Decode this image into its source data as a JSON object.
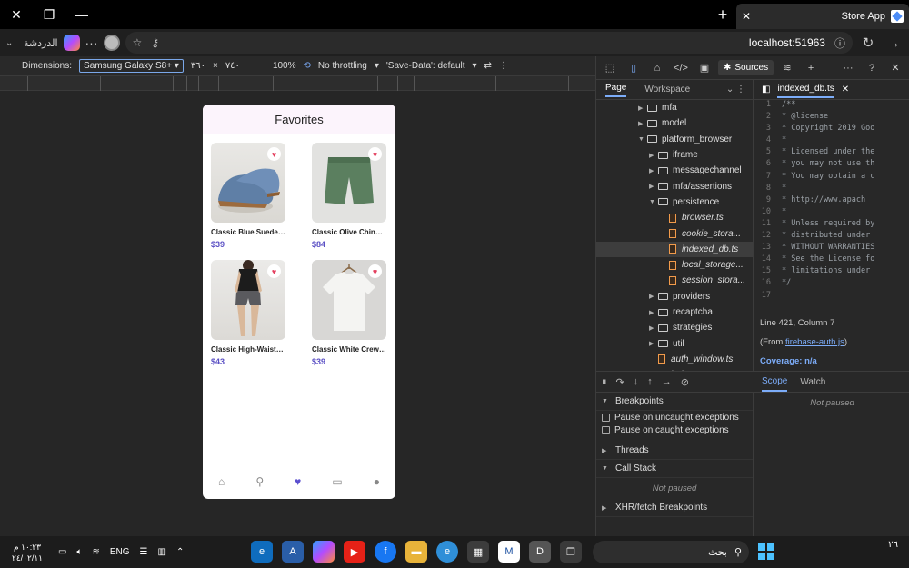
{
  "window": {
    "tab_title": "Store App"
  },
  "addressbar": {
    "copilot_label": "الدردشة",
    "url": "localhost:51963"
  },
  "device_toolbar": {
    "dimensions_label": "Dimensions:",
    "device": "Samsung Galaxy S8+",
    "width": "٣٦٠",
    "height": "٧٤٠",
    "zoom": "100%",
    "throttling": "No throttling",
    "save_data": "'Save-Data': default"
  },
  "app": {
    "header_title": "Favorites",
    "products": [
      {
        "name": "Classic Blue Suede ...",
        "price": "$39"
      },
      {
        "name": "Classic Olive Chino ...",
        "price": "$84"
      },
      {
        "name": "Classic High-Waiste...",
        "price": "$43"
      },
      {
        "name": "Classic White Crew ...",
        "price": "$39"
      }
    ]
  },
  "devtools": {
    "sources_tab": "Sources",
    "nav_tabs": [
      "Page",
      "Workspace"
    ],
    "tree": [
      {
        "label": "mfa",
        "type": "folder",
        "depth": 2,
        "expanded": false
      },
      {
        "label": "model",
        "type": "folder",
        "depth": 2,
        "expanded": false
      },
      {
        "label": "platform_browser",
        "type": "folder",
        "depth": 2,
        "expanded": true
      },
      {
        "label": "iframe",
        "type": "folder",
        "depth": 3,
        "expanded": false
      },
      {
        "label": "messagechannel",
        "type": "folder",
        "depth": 3,
        "expanded": false
      },
      {
        "label": "mfa/assertions",
        "type": "folder",
        "depth": 3,
        "expanded": false
      },
      {
        "label": "persistence",
        "type": "folder",
        "depth": 3,
        "expanded": true
      },
      {
        "label": "browser.ts",
        "type": "file",
        "depth": 4
      },
      {
        "label": "cookie_stora...",
        "type": "file",
        "depth": 4
      },
      {
        "label": "indexed_db.ts",
        "type": "file",
        "depth": 4,
        "selected": true
      },
      {
        "label": "local_storage...",
        "type": "file",
        "depth": 4
      },
      {
        "label": "session_stora...",
        "type": "file",
        "depth": 4
      },
      {
        "label": "providers",
        "type": "folder",
        "depth": 3,
        "expanded": false
      },
      {
        "label": "recaptcha",
        "type": "folder",
        "depth": 3,
        "expanded": false
      },
      {
        "label": "strategies",
        "type": "folder",
        "depth": 3,
        "expanded": false
      },
      {
        "label": "util",
        "type": "folder",
        "depth": 3,
        "expanded": false
      },
      {
        "label": "auth_window.ts",
        "type": "file",
        "depth": 3
      },
      {
        "label": "index.ts",
        "type": "file",
        "depth": 3
      }
    ],
    "editor_tab": "indexed_db.ts",
    "code_lines": [
      "/**",
      " * @license",
      " * Copyright 2019 Goo",
      " *",
      " * Licensed under the",
      " * you may not use th",
      " * You may obtain a c",
      " *",
      " *   http://www.apach",
      " *",
      " * Unless required by",
      " * distributed under",
      " * WITHOUT WARRANTIES",
      " * See the License fo",
      " * limitations under",
      " */",
      ""
    ],
    "cursor_position": "Line 421, Column 7",
    "from_prefix": "(From ",
    "from_link": "firebase-auth.js",
    "from_suffix": ")",
    "coverage": "Coverage: n/a",
    "breakpoints_label": "Breakpoints",
    "pause_uncaught": "Pause on uncaught exceptions",
    "pause_caught": "Pause on caught exceptions",
    "threads_label": "Threads",
    "callstack_label": "Call Stack",
    "not_paused": "Not paused",
    "xhr_label": "XHR/fetch Breakpoints",
    "scope_tab": "Scope",
    "watch_tab": "Watch",
    "scope_not_paused": "Not paused"
  },
  "taskbar": {
    "time": "١٠:٢٣ م",
    "date": "٢٤/٠٢/١١",
    "lang": "ENG",
    "search_placeholder": "بحث",
    "corner_number": "٢٦"
  }
}
